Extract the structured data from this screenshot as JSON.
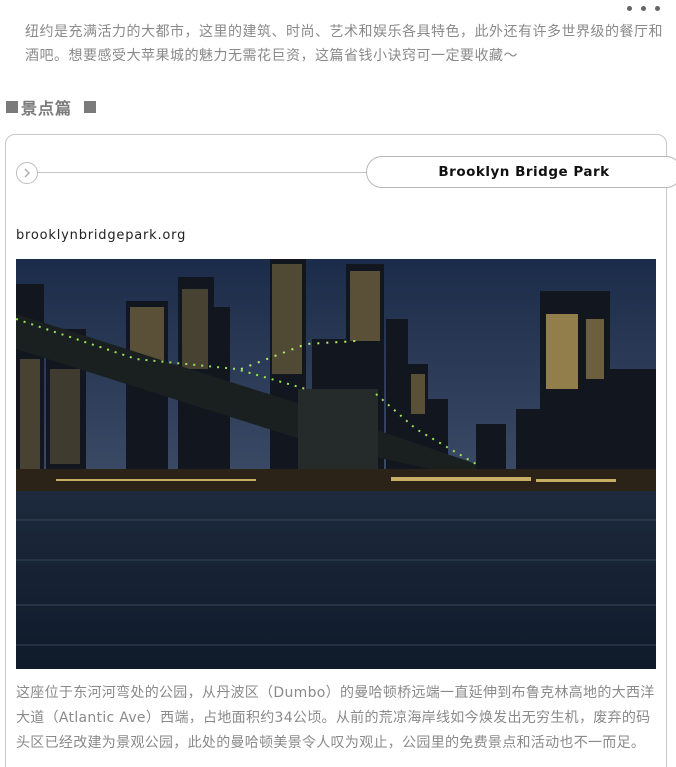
{
  "intro_text": "纽约是充满活力的大都市，这里的建筑、时尚、艺术和娱乐各具特色，此外还有许多世界级的餐厅和酒吧。想要感受大苹果城的魅力无需花巨资，这篇省钱小诀窍可一定要收藏～",
  "section": {
    "title": "景点篇"
  },
  "attraction": {
    "name": "Brooklyn Bridge Park",
    "url": "brooklynbridgepark.org",
    "photo_subject": "Brooklyn Bridge and Manhattan skyline at dusk",
    "description": "这座位于东河河弯处的公园，从丹波区（Dumbo）的曼哈顿桥远端一直延伸到布鲁克林高地的大西洋大道（Atlantic Ave）西端，占地面积约34公顷。从前的荒凉海岸线如今焕发出无穷生机，废弃的码头区已经改建为景观公园，此处的曼哈顿美景令人叹为观止，公园里的免费景点和活动也不一而足。"
  },
  "icons": {
    "more": "more-dots-icon",
    "arrow": "chevron-right-circle-icon"
  },
  "colors": {
    "accent_gray": "#7b7b7b",
    "body_text": "#8a8a8a"
  }
}
